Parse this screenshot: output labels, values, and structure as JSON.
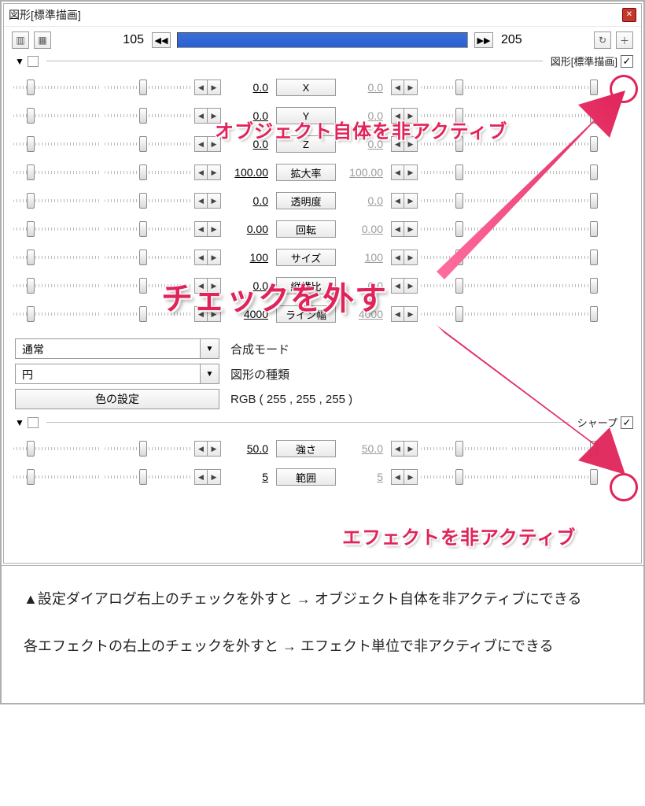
{
  "title": "図形[標準描画]",
  "frame": {
    "start": "105",
    "end": "205"
  },
  "section1": {
    "label": "図形[標準描画]",
    "checked": "✓"
  },
  "params": [
    {
      "label": "X",
      "l": "0.0",
      "r": "0.0"
    },
    {
      "label": "Y",
      "l": "0.0",
      "r": "0.0"
    },
    {
      "label": "Z",
      "l": "0.0",
      "r": "0.0"
    },
    {
      "label": "拡大率",
      "l": "100.00",
      "r": "100.00"
    },
    {
      "label": "透明度",
      "l": "0.0",
      "r": "0.0"
    },
    {
      "label": "回転",
      "l": "0.00",
      "r": "0.00"
    },
    {
      "label": "サイズ",
      "l": "100",
      "r": "100"
    },
    {
      "label": "縦横比",
      "l": "0.0",
      "r": "0.0"
    },
    {
      "label": "ライン幅",
      "l": "4000",
      "r": "4000"
    }
  ],
  "combos": {
    "blend_label": "合成モード",
    "blend_value": "通常",
    "shape_label": "図形の種類",
    "shape_value": "円",
    "color_btn": "色の設定",
    "color_text": "RGB ( 255 , 255 , 255 )"
  },
  "section2": {
    "label": "シャープ",
    "checked": "✓"
  },
  "params2": [
    {
      "label": "強さ",
      "l": "50.0",
      "r": "50.0"
    },
    {
      "label": "範囲",
      "l": "5",
      "r": "5"
    }
  ],
  "annot": {
    "obj": "オブジェクト自体を非アクティブ",
    "main": "チェックを外す",
    "eff": "エフェクトを非アクティブ"
  },
  "caption": {
    "p1": "▲設定ダイアログ右上のチェックを外すと → オブジェクト自体を非アクティブにできる",
    "p2": "各エフェクトの右上のチェックを外すと → エフェクト単位で非アクティブにできる"
  }
}
